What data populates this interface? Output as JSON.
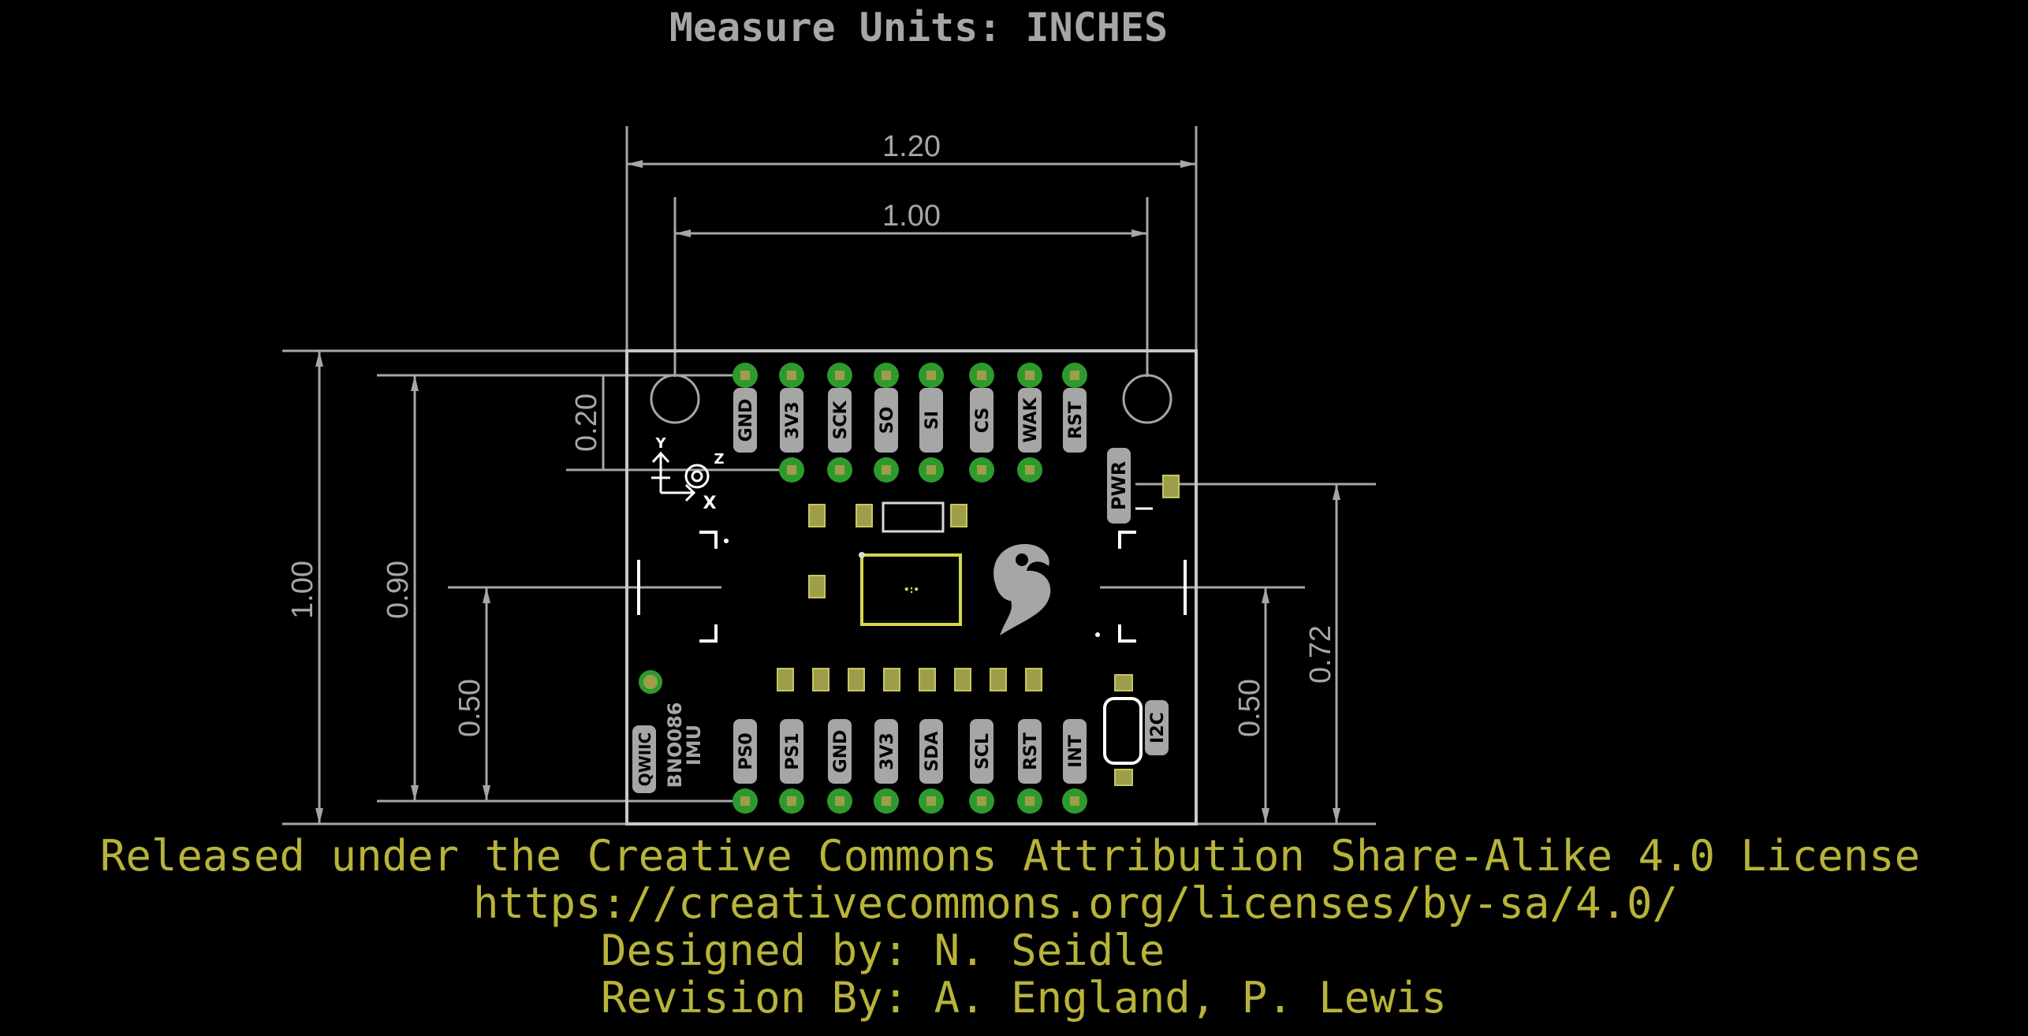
{
  "title": "Measure Units: INCHES",
  "dimensions": {
    "width_outer": "1.20",
    "width_holes": "1.00",
    "height_outer": "1.00",
    "height_pins": "0.90",
    "hole_offset": "0.20",
    "center_left": "0.50",
    "center_right": "0.50",
    "pwr_height": "0.72"
  },
  "top_pins": [
    "GND",
    "3V3",
    "SCK",
    "SO",
    "SI",
    "CS",
    "WAK",
    "RST"
  ],
  "bottom_pins": [
    "PS0",
    "PS1",
    "GND",
    "3V3",
    "SDA",
    "SCL",
    "RST",
    "INT"
  ],
  "board_labels": {
    "pwr": "PWR",
    "i2c": "I2C",
    "qwiic": "QWIIC",
    "part_name": "BNO086",
    "part_desc": "IMU",
    "axis_x": "X",
    "axis_y": "Y",
    "axis_z": "Z"
  },
  "credits": {
    "license": "Released under the Creative Commons Attribution Share-Alike 4.0 License",
    "url": "https://creativecommons.org/licenses/by-sa/4.0/",
    "designed": "Designed by: N. Seidle",
    "revision": "Revision By: A. England, P. Lewis"
  },
  "colors": {
    "background": "#000000",
    "dimension": "#a6a6a6",
    "board_outline": "#c8c8c8",
    "pad_ring": "#2e9a2e",
    "pad_center": "#9e9e4a",
    "silkscreen": "#d9d9d9",
    "credits": "#b8b33a"
  }
}
